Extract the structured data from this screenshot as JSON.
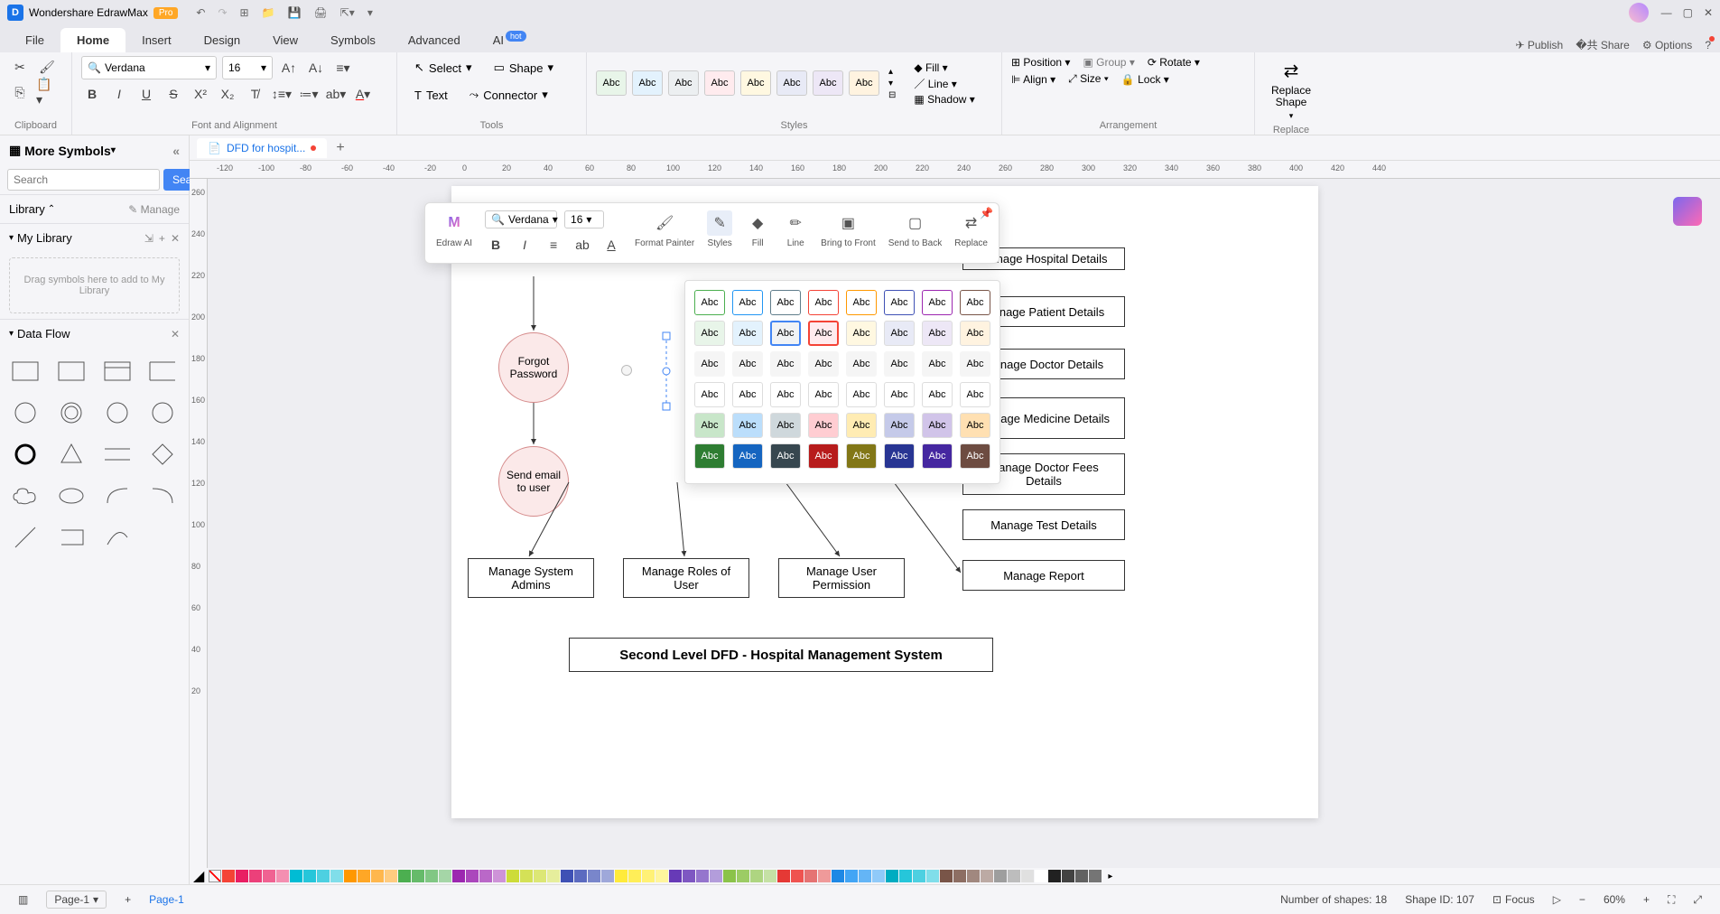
{
  "app": {
    "title": "Wondershare EdrawMax",
    "pro_badge": "Pro"
  },
  "menu": {
    "tabs": [
      "File",
      "Home",
      "Insert",
      "Design",
      "View",
      "Symbols",
      "Advanced",
      "AI"
    ],
    "active_index": 1,
    "right": {
      "publish": "Publish",
      "share": "Share",
      "options": "Options"
    }
  },
  "ribbon": {
    "font_name": "Verdana",
    "font_size": "16",
    "select": "Select",
    "shape": "Shape",
    "text": "Text",
    "connector": "Connector",
    "fill": "Fill",
    "line": "Line",
    "shadow": "Shadow",
    "position": "Position",
    "group": "Group",
    "rotate": "Rotate",
    "align": "Align",
    "size": "Size",
    "lock": "Lock",
    "replace_shape": "Replace Shape",
    "groups": {
      "clipboard": "Clipboard",
      "font": "Font and Alignment",
      "tools": "Tools",
      "styles": "Styles",
      "arrangement": "Arrangement",
      "replace": "Replace"
    },
    "style_label": "Abc"
  },
  "sidebar": {
    "more_symbols": "More Symbols",
    "search_placeholder": "Search",
    "search_btn": "Search",
    "library": "Library",
    "manage": "Manage",
    "my_library": "My Library",
    "drop_hint": "Drag symbols here to add to My Library",
    "data_flow": "Data Flow"
  },
  "doctab": {
    "name": "DFD for hospit..."
  },
  "canvas": {
    "circ1": "Forgot Password",
    "circ2": "Send email to user",
    "r1": "Manage Hospital Details",
    "r2": "Manage Patient Details",
    "r3": "Manage Doctor Details",
    "r4": "Manage Medicine Details",
    "r5": "Manage Doctor Fees Details",
    "r6": "Manage Test Details",
    "r7": "Manage Report",
    "r8": "Manage System Admins",
    "r9": "Manage Roles of User",
    "r10": "Manage User Permission",
    "title": "Second Level DFD - Hospital Management System"
  },
  "minitb": {
    "edraw_ai": "Edraw AI",
    "font": "Verdana",
    "size": "16",
    "format_painter": "Format Painter",
    "styles": "Styles",
    "fill": "Fill",
    "line": "Line",
    "bring_front": "Bring to Front",
    "send_back": "Send to Back",
    "replace": "Replace",
    "abc": "Abc"
  },
  "status": {
    "page_combo": "Page-1",
    "page_tab": "Page-1",
    "shapes": "Number of shapes: 18",
    "shape_id": "Shape ID: 107",
    "focus": "Focus",
    "zoom": "60%"
  },
  "ruler_h": [
    "-120",
    "-100",
    "-80",
    "-60",
    "-40",
    "-20",
    "0",
    "20",
    "40",
    "60",
    "80",
    "100",
    "120",
    "140",
    "160",
    "180",
    "200",
    "220",
    "240",
    "260",
    "280",
    "300",
    "320",
    "340",
    "360",
    "380",
    "400",
    "420",
    "440"
  ],
  "ruler_v": [
    "260",
    "240",
    "220",
    "200",
    "180",
    "160",
    "140",
    "120",
    "100",
    "80",
    "60",
    "40",
    "20"
  ],
  "colors": [
    "#f44336",
    "#e91e63",
    "#ec407a",
    "#f06292",
    "#f48fb1",
    "#00bcd4",
    "#26c6da",
    "#4dd0e1",
    "#80deea",
    "#ff9800",
    "#ffa726",
    "#ffb74d",
    "#ffcc80",
    "#4caf50",
    "#66bb6a",
    "#81c784",
    "#a5d6a7",
    "#9c27b0",
    "#ab47bc",
    "#ba68c8",
    "#ce93d8",
    "#cddc39",
    "#d4e157",
    "#dce775",
    "#e6ee9c",
    "#3f51b5",
    "#5c6bc0",
    "#7986cb",
    "#9fa8da",
    "#ffeb3b",
    "#ffee58",
    "#fff176",
    "#fff59d",
    "#673ab7",
    "#7e57c2",
    "#9575cd",
    "#b39ddb",
    "#8bc34a",
    "#9ccc65",
    "#aed581",
    "#c5e1a5",
    "#e53935",
    "#ef5350",
    "#e57373",
    "#ef9a9a",
    "#1e88e5",
    "#42a5f5",
    "#64b5f6",
    "#90caf9",
    "#00acc1",
    "#26c6da",
    "#4dd0e1",
    "#80deea",
    "#795548",
    "#8d6e63",
    "#a1887f",
    "#bcaaa4",
    "#9e9e9e",
    "#bdbdbd",
    "#e0e0e0",
    "#ffffff",
    "#212121",
    "#424242",
    "#616161",
    "#757575"
  ]
}
